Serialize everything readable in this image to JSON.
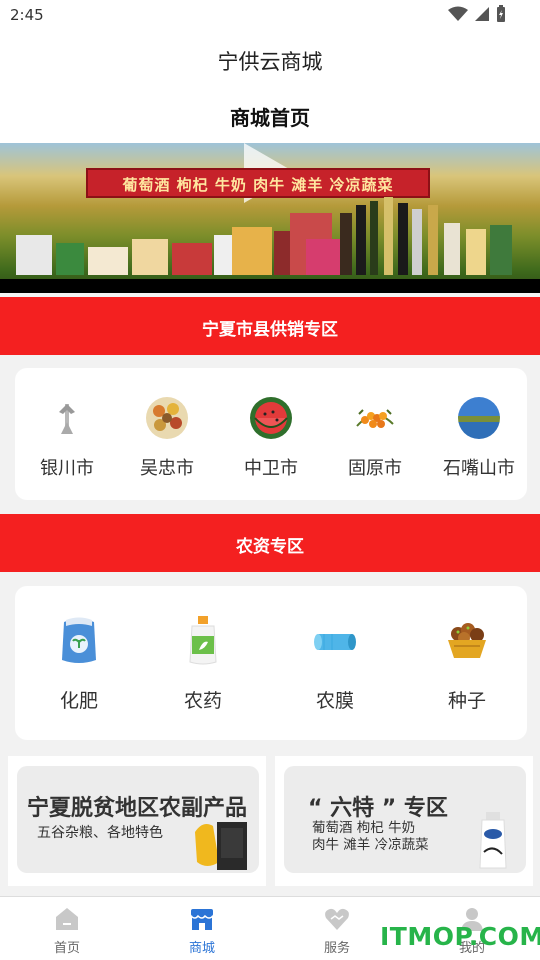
{
  "status_bar": {
    "time": "2:45"
  },
  "app": {
    "title": "宁供云商城"
  },
  "page": {
    "title": "商城首页"
  },
  "banner": {
    "ribbon_text": "葡萄酒 枸杞 牛奶 肉牛 滩羊 冷凉蔬菜"
  },
  "section_supply": {
    "title": "宁夏市县供销专区",
    "cities": [
      {
        "label": "银川市",
        "icon": "monument-icon"
      },
      {
        "label": "吴忠市",
        "icon": "food-platter-icon"
      },
      {
        "label": "中卫市",
        "icon": "watermelon-icon"
      },
      {
        "label": "固原市",
        "icon": "sea-buckthorn-icon"
      },
      {
        "label": "石嘴山市",
        "icon": "lake-landscape-icon"
      }
    ]
  },
  "section_agri": {
    "title": "农资专区",
    "items": [
      {
        "label": "化肥",
        "icon": "fertilizer-bag-icon"
      },
      {
        "label": "农药",
        "icon": "pesticide-bottle-icon"
      },
      {
        "label": "农膜",
        "icon": "plastic-film-roll-icon"
      },
      {
        "label": "种子",
        "icon": "seed-basket-icon"
      }
    ]
  },
  "promos": [
    {
      "title": "宁夏脱贫地区农副产品",
      "subtitle": "五谷杂粮、各地特色"
    },
    {
      "title": "“ 六特 ” 专区",
      "line1": "葡萄酒 枸杞 牛奶",
      "line2": "肉牛  滩羊  冷凉蔬菜"
    }
  ],
  "bottom_nav": [
    {
      "label": "首页",
      "icon": "home-icon",
      "active": false
    },
    {
      "label": "商城",
      "icon": "store-icon",
      "active": true
    },
    {
      "label": "服务",
      "icon": "heart-handshake-icon",
      "active": false
    },
    {
      "label": "我的",
      "icon": "user-icon",
      "active": false
    }
  ],
  "watermark": "ITMOP.COM",
  "colors": {
    "section_red": "#f42020",
    "active_blue": "#2b74d6",
    "watermark_green": "#27b44a"
  }
}
